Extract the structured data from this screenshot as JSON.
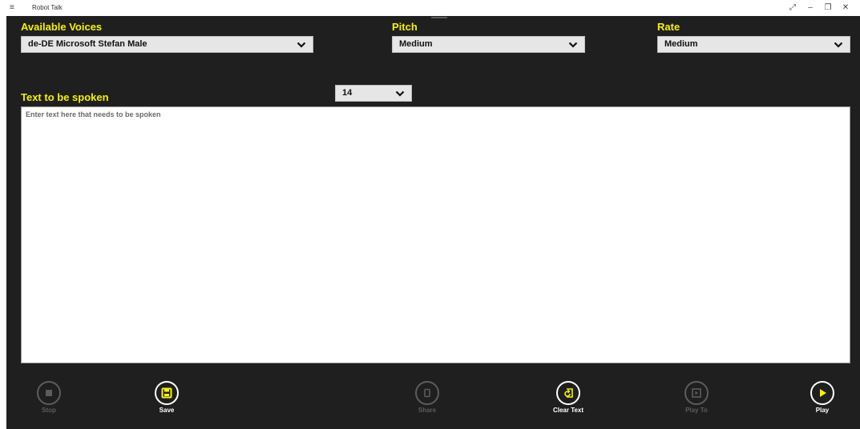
{
  "window": {
    "title": "Robot Talk",
    "menu_icon": "≡",
    "buttons": {
      "fullscreen": "⤢",
      "minimize": "–",
      "restore": "❐",
      "close": "✕"
    }
  },
  "voices": {
    "label": "Available Voices",
    "selected": "de-DE Microsoft Stefan Male"
  },
  "pitch": {
    "label": "Pitch",
    "selected": "Medium"
  },
  "rate": {
    "label": "Rate",
    "selected": "Medium"
  },
  "font_size": {
    "selected": "14"
  },
  "text_area": {
    "label": "Text to be spoken",
    "placeholder": "Enter text here that needs to be spoken"
  },
  "app_bar": {
    "stop": {
      "label": "Stop",
      "icon": "stop-icon"
    },
    "save": {
      "label": "Save",
      "icon": "save-icon"
    },
    "share": {
      "label": "Share",
      "icon": "share-icon"
    },
    "clear": {
      "label": "Clear Text",
      "icon": "clear-text-icon"
    },
    "play_to": {
      "label": "Play To",
      "icon": "play-to-icon"
    },
    "play": {
      "label": "Play",
      "icon": "play-icon"
    }
  },
  "colors": {
    "accent": "#f3f300",
    "background": "#1f1f1f",
    "disabled": "#5c5c5c"
  }
}
